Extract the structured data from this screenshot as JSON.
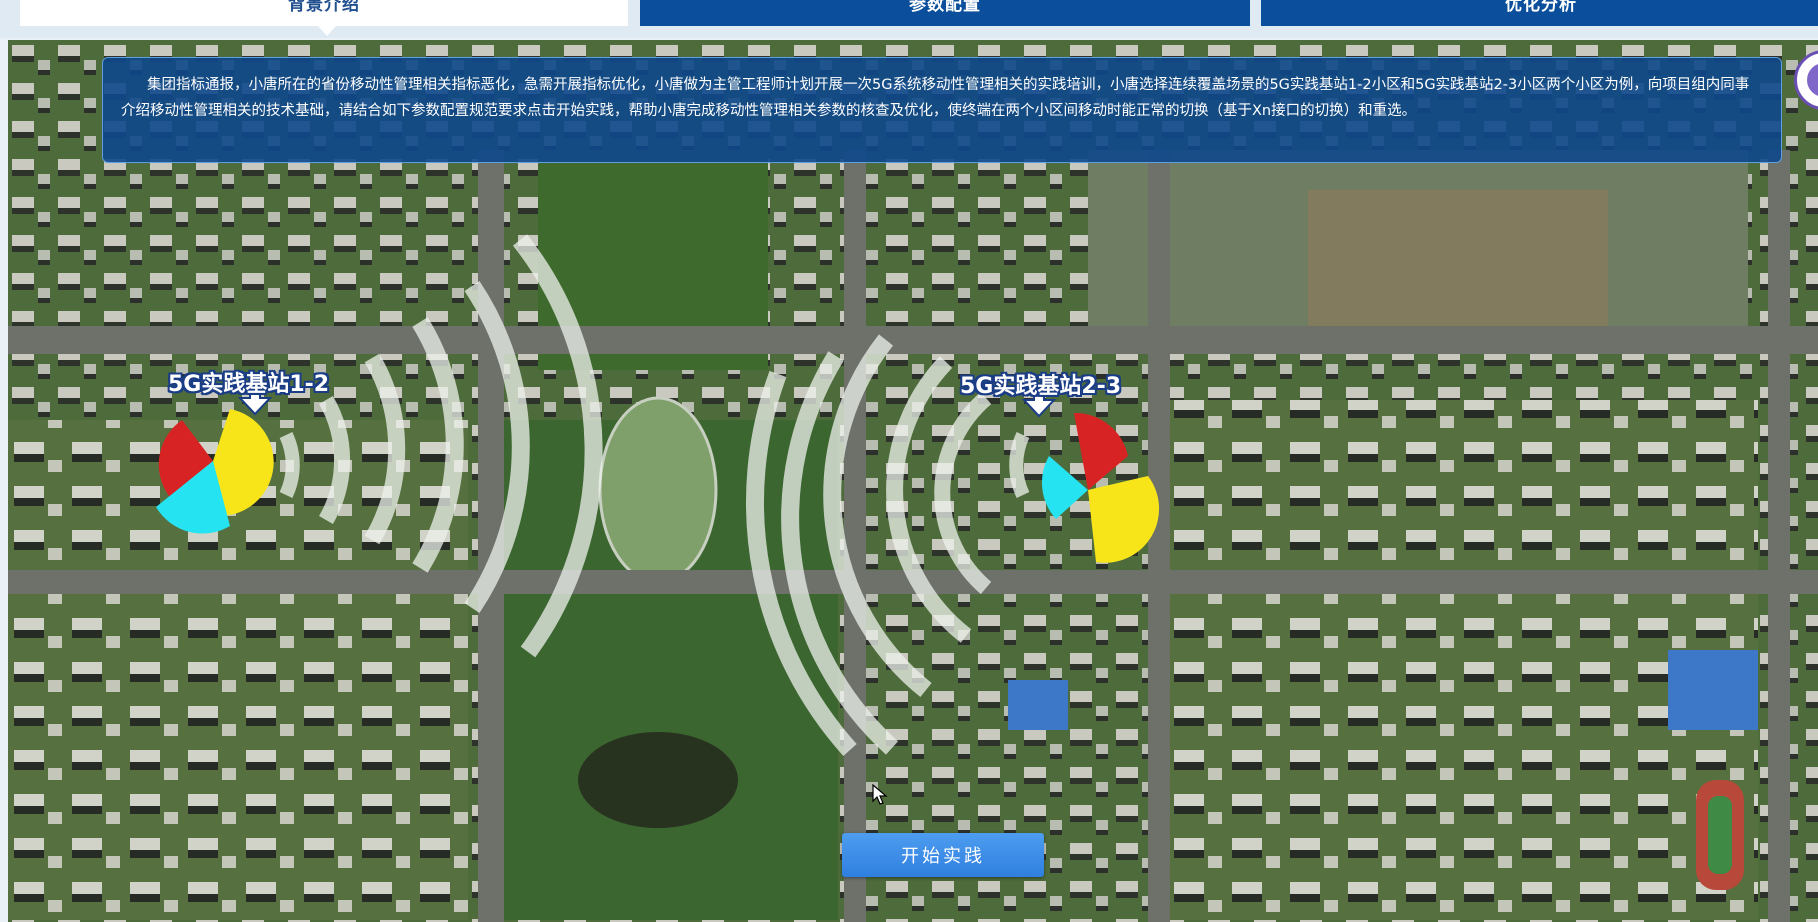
{
  "tabs": [
    {
      "label": "背景介绍",
      "active": true
    },
    {
      "label": "参数配置",
      "active": false
    },
    {
      "label": "优化分析",
      "active": false
    }
  ],
  "intro": {
    "text": "集团指标通报，小唐所在的省份移动性管理相关指标恶化，急需开展指标优化，小唐做为主管工程师计划开展一次5G系统移动性管理相关的实践培训，小唐选择连续覆盖场景的5G实践基站1-2小区和5G实践基站2-3小区两个小区为例，向项目组内同事介绍移动性管理相关的技术基础，请结合如下参数配置规范要求点击开始实践，帮助小唐完成移动性管理相关参数的核查及优化，使终端在两个小区间移动时能正常的切换（基于Xn接口的切换）和重选。"
  },
  "stations": [
    {
      "label": "5G实践基站1-2"
    },
    {
      "label": "5G实践基站2-3"
    }
  ],
  "colors": {
    "sector_red": "#d72323",
    "sector_yellow": "#f7e51a",
    "sector_cyan": "#26e3f2",
    "tab_active_bg": "#ffffff",
    "tab_inactive_bg": "#0b4f9c",
    "intro_bg": "#0e488c",
    "button_bg": "#3c8ee8"
  },
  "icons": {
    "station_arrow": "down-arrow-icon",
    "corner": "avatar-icon",
    "cursor": "mouse-pointer-icon"
  },
  "start_button": {
    "label": "开始实践"
  }
}
